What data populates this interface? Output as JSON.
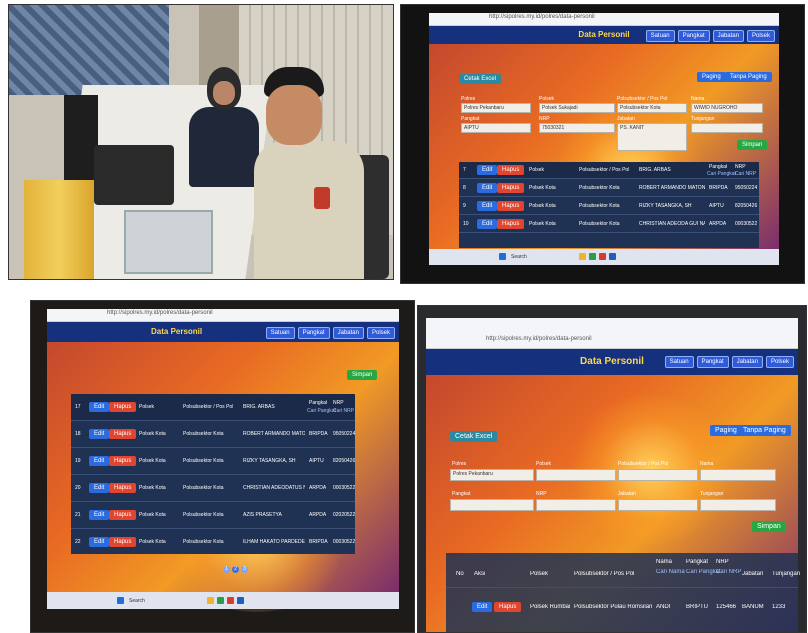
{
  "app": {
    "title": "Data Personil",
    "nav": [
      "Satuan",
      "Pangkat",
      "Jabatan",
      "Polsek"
    ],
    "url": "http://sipolres.my.id/polres/data-personil",
    "buttons": {
      "cetak": "Cetak Excel",
      "paging": "Paging",
      "tanpa_paging": "Tanpa Paging",
      "simpan": "Simpan",
      "edit": "Edit",
      "hapus": "Hapus"
    },
    "form_labels": {
      "polres": "Polres",
      "polsek": "Polsek",
      "polsubsektor": "Polsubsektor / Pos Pol",
      "nama": "Nama",
      "pangkat": "Pangkat",
      "nrp": "NRP",
      "jabatan": "Jabatan",
      "tunjangan": "Tunjangan"
    },
    "form_values": {
      "polres": "Polres Pekanbaru",
      "polsek": "Polsek Sukajadi",
      "polsubsektor": "Polsubsektor Kota",
      "nama": "WIWID NUGROHO",
      "pangkat": "AIPTU",
      "nrp": "75030321",
      "jabatan": "PS. KANIT"
    },
    "filter_labels": [
      "Cari Pangkat",
      "Cari NRP"
    ],
    "table_headers": [
      "No",
      "Aksi",
      "Polsek",
      "Polsubsektor / Pos Pol",
      "Nama",
      "Pangkat",
      "NRP"
    ],
    "rows_screen2": [
      {
        "no": "7",
        "polsek": "Polsek Kota",
        "sub": "Polsubsektor Kota",
        "nama": "BRIG. ARBAS",
        "pangkat": "",
        "nrp": ""
      },
      {
        "no": "8",
        "polsek": "Polsek Kota",
        "sub": "Polsubsektor Kota",
        "nama": "ROBERT ARMANDO MATONDANG",
        "pangkat": "BRIPDA",
        "nrp": "95050224"
      },
      {
        "no": "9",
        "polsek": "Polsek Kota",
        "sub": "Polsubsektor Kota",
        "nama": "RIZKY TASANGKA, SH",
        "pangkat": "AIPTU",
        "nrp": "82050426"
      },
      {
        "no": "10",
        "polsek": "Polsek Kota",
        "sub": "Polsubsektor Kota",
        "nama": "CHRISTIAN ADEODA GUI NAINGGOLA",
        "pangkat": "ARPDA",
        "nrp": "00030522"
      }
    ],
    "rows_screen3": [
      {
        "no": "17",
        "polsek": "Polsek",
        "sub": "Polsubsektor / Pos Pol",
        "nama": "BRIG. ARBAS",
        "pangkat": "Pangkat",
        "nrp": "NRP"
      },
      {
        "no": "18",
        "polsek": "Polsek Kota",
        "sub": "Polsubsektor Kota",
        "nama": "ROBERT ARMANDO MATONDANG",
        "pangkat": "BRIPDA",
        "nrp": "95050224"
      },
      {
        "no": "19",
        "polsek": "Polsek Kota",
        "sub": "Polsubsektor Kota",
        "nama": "RIZKY TASANGKA, SH",
        "pangkat": "AIPTU",
        "nrp": "82050426"
      },
      {
        "no": "20",
        "polsek": "Polsek Kota",
        "sub": "Polsubsektor Kota",
        "nama": "CHRISTIAN ADEODATUS NAINGGOLA",
        "pangkat": "ARPDA",
        "nrp": "00030522"
      },
      {
        "no": "21",
        "polsek": "Polsek Kota",
        "sub": "Polsubsektor Kota",
        "nama": "AZIS PRASETYA",
        "pangkat": "ARPDA",
        "nrp": "02020522"
      },
      {
        "no": "22",
        "polsek": "Polsek Kota",
        "sub": "Polsubsektor Kota",
        "nama": "ILHAM HAKATO PARDEDE",
        "pangkat": "BRIPDA",
        "nrp": "00030522"
      }
    ],
    "pages": [
      "1",
      "2",
      "3"
    ],
    "screen4": {
      "polres_value": "Polres Pekanbaru",
      "headers": [
        "No",
        "Aksi",
        "Polsek",
        "Polsubsektor / Pos Pol",
        "Nama",
        "Pangkat",
        "NRP",
        "Jabatan",
        "Tunjangan"
      ],
      "row": {
        "polsek": "Polsek Rumbai",
        "sub": "Polsubsektor Pulau Romsilam",
        "nama": "ANDI",
        "pangkat": "BRIPTU",
        "nrp": "125466",
        "jabatan": "BANUM",
        "tunjangan": "1233"
      },
      "search_label": "Cari Nama"
    },
    "search_placeholder": "Search"
  },
  "colors": {
    "header": "#15307c",
    "title": "#ffd84a",
    "edit": "#2a6be0",
    "hapus": "#e0452f",
    "simpan": "#27a744",
    "table": "#203253"
  }
}
